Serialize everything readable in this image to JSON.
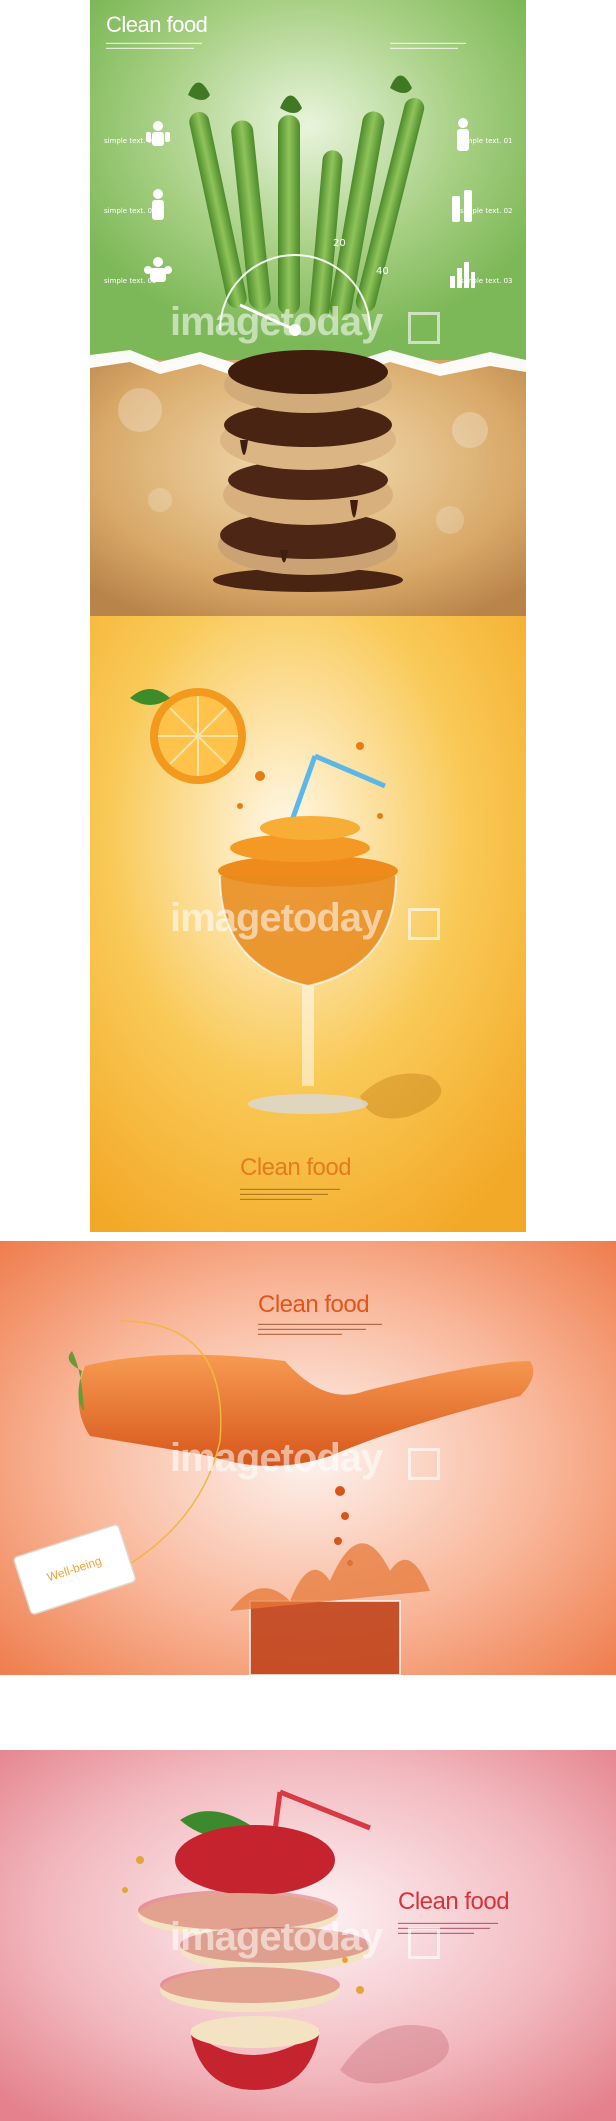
{
  "panels": [
    {
      "id": "asparagus",
      "title": "Clean food",
      "left_labels": [
        "simple text. 01",
        "simple text. 02",
        "simple text. 03"
      ],
      "right_labels": [
        "simple text. 01",
        "simple text. 02",
        "simple text. 03"
      ],
      "gauge_numbers": [
        "20",
        "40"
      ],
      "icons": [
        "person-icon",
        "person-icon",
        "person-strong-icon",
        "person-exercise-icon",
        "bottle-icon",
        "bar-chart-icon"
      ]
    },
    {
      "id": "orange",
      "title": "Clean food"
    },
    {
      "id": "carrot",
      "title": "Clean food",
      "tag": "Well-being"
    },
    {
      "id": "apple",
      "title": "Clean food"
    }
  ],
  "watermark": "imagetoday",
  "colors": {
    "green_bg": "#8fc46a",
    "orange_bg": "#f5b63b",
    "carrot_bg": "#f28a5c",
    "apple_bg": "#e98c96",
    "title_orange": "#e67a1f",
    "title_red": "#d9333a"
  }
}
